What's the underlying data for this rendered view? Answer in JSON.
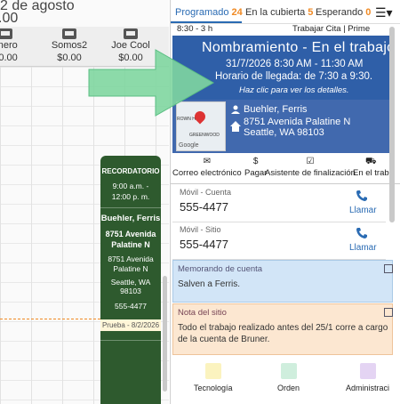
{
  "calendar": {
    "date_header": "2 de agosto",
    "total_amount": ".00",
    "trucks": [
      {
        "name": "imero",
        "amount": "$0.00"
      },
      {
        "name": "Somos2",
        "amount": "$0.00"
      },
      {
        "name": "Joe Cool",
        "amount": "$0.00"
      }
    ],
    "appointment": {
      "label": "RECORDATORIO",
      "time": "9:00 a.m. - 12:00 p. m.",
      "customer": "Buehler, Ferris",
      "street": "8751 Avenida Palatine N",
      "street_small": "8751 Avenida Palatine N",
      "city": "Seattle, WA 98103",
      "phone": "555-4477",
      "tag": "Prueba - 8/2/2026"
    }
  },
  "tabs": [
    {
      "label": "Programado",
      "count": "24"
    },
    {
      "label": "En la cubierta",
      "count": "5"
    },
    {
      "label": "Esperando",
      "count": "0"
    }
  ],
  "subbar": {
    "time": "8:30 - 3 h",
    "work": "Trabajar Cita | Prime"
  },
  "job": {
    "title": "Nombramiento - En el trabajo",
    "date": "31/7/2026 8:30 AM - 11:30 AM",
    "arrival": "Horario de llegada: de 7:30 a 9:30.",
    "hint": "Haz clic para ver los detalles."
  },
  "customer": {
    "name": "Buehler, Ferris",
    "address1": "8751 Avenida Palatine N",
    "address2": "Seattle, WA 98103",
    "map_label1": "ROWN H",
    "map_label2": "GREENWOOD",
    "map_brand": "Google"
  },
  "actions": [
    {
      "label": "Correo electrónico",
      "icon": "envelope-icon",
      "glyph": "✉"
    },
    {
      "label": "Pagar",
      "icon": "dollar-icon",
      "glyph": "$"
    },
    {
      "label": "Asistente de finalización",
      "icon": "calendar-check-icon",
      "glyph": "☑"
    },
    {
      "label": "En el trab",
      "icon": "truck-icon",
      "glyph": "⛟"
    }
  ],
  "phones": [
    {
      "label": "Móvil - Cuenta",
      "number": "555-4477",
      "call": "Llamar"
    },
    {
      "label": "Móvil - Sitio",
      "number": "555-4477",
      "call": "Llamar"
    }
  ],
  "memo": {
    "heading": "Memorando de cuenta",
    "body": "Salven a Ferris."
  },
  "site_note": {
    "heading": "Nota del sitio",
    "body": "Todo el trabajo realizado antes del 25/1 corre a cargo de la cuenta de Bruner."
  },
  "bottom": [
    {
      "label": "Tecnología",
      "color": "#fbf3bf"
    },
    {
      "label": "Orden",
      "color": "#cfeedd"
    },
    {
      "label": "Administraci",
      "color": "#e4d4f3"
    }
  ],
  "colors": {
    "accent": "#2a6bb3",
    "count": "#f08a24",
    "job_header": "#2f5fa8",
    "appointment": "#2e5a2e",
    "arrow": "#7fd6a0"
  }
}
